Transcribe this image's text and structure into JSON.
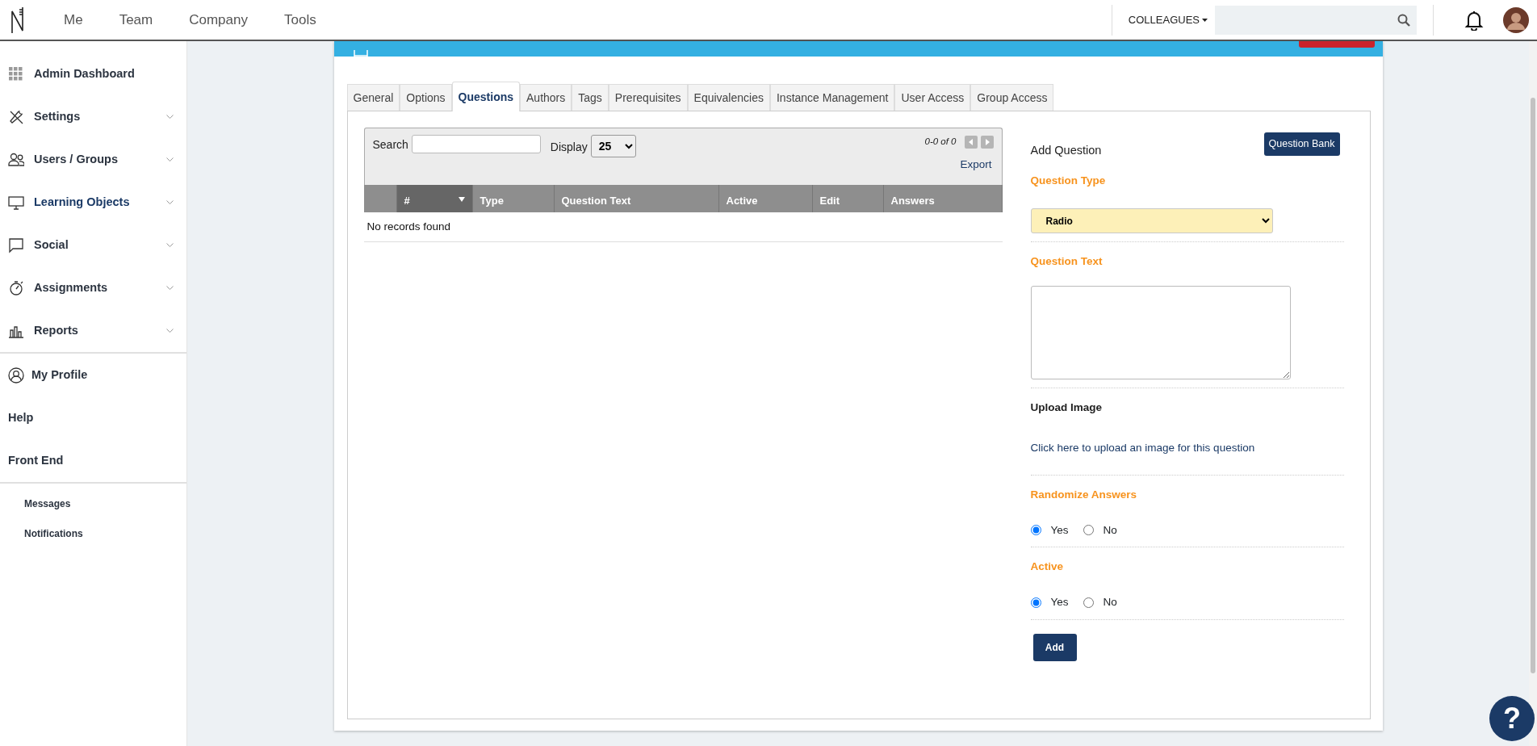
{
  "topbar": {
    "nav": [
      {
        "label": "Me"
      },
      {
        "label": "Team"
      },
      {
        "label": "Company"
      },
      {
        "label": "Tools"
      }
    ],
    "colleagues": "COLLEAGUES"
  },
  "sidebar": {
    "groups": [
      {
        "kind": "main",
        "items": [
          {
            "label": "Admin Dashboard",
            "selected": false
          },
          {
            "label": "Settings",
            "selected": false,
            "expanded": false
          },
          {
            "label": "Users / Groups",
            "selected": false,
            "expanded": false
          },
          {
            "label": "Learning Objects",
            "selected": true,
            "expanded": false
          },
          {
            "label": "Social",
            "selected": false,
            "expanded": false
          },
          {
            "label": "Assignments",
            "selected": false,
            "expanded": false
          },
          {
            "label": "Reports",
            "selected": false,
            "expanded": false
          }
        ]
      },
      {
        "kind": "account",
        "items": [
          {
            "label": "My Profile",
            "selected": false
          },
          {
            "label": "Help",
            "selected": false
          },
          {
            "label": "Front End",
            "selected": false
          }
        ]
      },
      {
        "kind": "sub",
        "items": [
          {
            "label": "Messages",
            "selected": false
          },
          {
            "label": "Notifications",
            "selected": false
          }
        ]
      }
    ]
  },
  "tabs": [
    {
      "label": "General",
      "selected": false
    },
    {
      "label": "Options",
      "selected": false
    },
    {
      "label": "Questions",
      "selected": true
    },
    {
      "label": "Authors",
      "selected": false
    },
    {
      "label": "Tags",
      "selected": false
    },
    {
      "label": "Prerequisites",
      "selected": false
    },
    {
      "label": "Equivalencies",
      "selected": false
    },
    {
      "label": "Instance Management",
      "selected": false
    },
    {
      "label": "User Access",
      "selected": false
    },
    {
      "label": "Group Access",
      "selected": false
    }
  ],
  "table": {
    "search_label": "Search",
    "display_label": "Display",
    "display_value": "25",
    "pager": "0-0 of 0",
    "export": "Export",
    "columns": [
      {
        "label": "#",
        "sorted": true
      },
      {
        "label": "Type",
        "sorted": false
      },
      {
        "label": "Question Text",
        "sorted": false
      },
      {
        "label": "Active",
        "sorted": false
      },
      {
        "label": "Edit",
        "sorted": false
      },
      {
        "label": "Answers",
        "sorted": false
      }
    ],
    "empty": "No records found"
  },
  "form": {
    "title": "Add Question",
    "bank_button": "Question Bank",
    "sections": [
      {
        "kind": "select",
        "label": "Question Type",
        "value": "Radio"
      },
      {
        "kind": "textarea",
        "label": "Question Text"
      },
      {
        "kind": "upload",
        "label": "Upload Image",
        "link": "Click here to upload an image for this question"
      },
      {
        "kind": "radio",
        "label": "Randomize Answers",
        "options": [
          {
            "label": "Yes",
            "selected": true
          },
          {
            "label": "No",
            "selected": false
          }
        ]
      },
      {
        "kind": "radio",
        "label": "Active",
        "options": [
          {
            "label": "Yes",
            "selected": true
          },
          {
            "label": "No",
            "selected": false
          }
        ]
      }
    ],
    "submit": "Add"
  },
  "help_button": "?"
}
